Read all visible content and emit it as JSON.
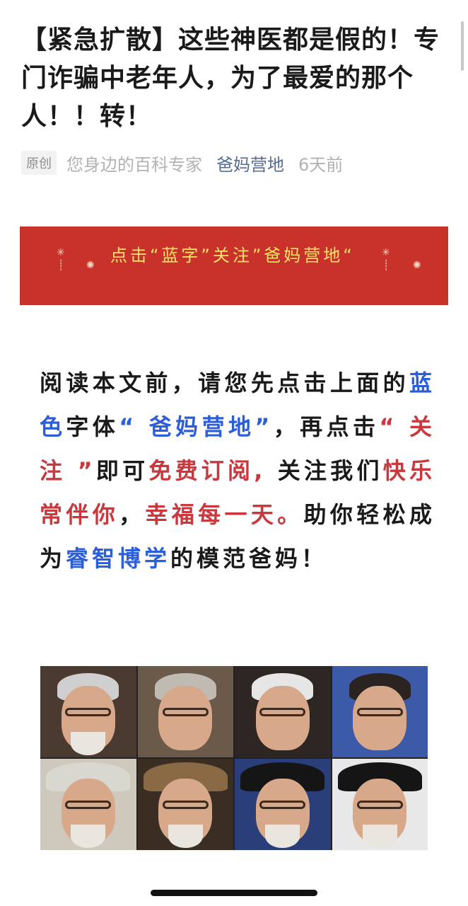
{
  "article": {
    "title": "【紧急扩散】这些神医都是假的！专门诈骗中老年人，为了最爱的那个人！！转！",
    "meta": {
      "badge": "原创",
      "author": "您身边的百科专家",
      "account": "爸妈营地",
      "time": "6天前"
    }
  },
  "banner": {
    "text": "点击“蓝字”关注”爸妈营地“"
  },
  "intro": {
    "p1": "阅读本文前，请您先点击上面的",
    "blue1": "蓝色",
    "p2": "字体",
    "blue2": "“ 爸妈营地”",
    "p3": "，再点击",
    "red1": "“ 关注 ”",
    "p4": "即可",
    "red2": "免费订阅,",
    "p5": " 关注我们",
    "red3": "快乐常伴你",
    "p6": "，",
    "red4": "幸福每一天。",
    "p7": "助你轻松成为",
    "blue3": "睿智博学",
    "p8": "的模范爸妈！"
  },
  "colors": {
    "banner_bg": "#c8322a",
    "banner_text": "#f7e36a",
    "account_link": "#576b95",
    "blue": "#2b5fd9",
    "red": "#c8383d"
  },
  "image": {
    "faces": [
      {
        "hair": "#cfcfcf",
        "bg": "#4a3a30",
        "glasses": true,
        "beard": true,
        "hat": null
      },
      {
        "hair": "#bfbab2",
        "bg": "#6b5a4a",
        "glasses": true,
        "beard": false,
        "hat": null
      },
      {
        "hair": "#e6e6e6",
        "bg": "#2d2623",
        "glasses": true,
        "beard": false,
        "hat": null
      },
      {
        "hair": "#2b2320",
        "bg": "#3c5aa8",
        "glasses": true,
        "beard": false,
        "hat": null
      },
      {
        "hair": "#d9d9d9",
        "bg": "#cfc8bc",
        "glasses": true,
        "beard": true,
        "hat": "#d8d8d0"
      },
      {
        "hair": "#7a5a3a",
        "bg": "#3a2e22",
        "glasses": true,
        "beard": true,
        "hat": "#8a6a45"
      },
      {
        "hair": "#111111",
        "bg": "#2a3f7a",
        "glasses": true,
        "beard": true,
        "hat": "#151515"
      },
      {
        "hair": "#111111",
        "bg": "#e8e8e8",
        "glasses": true,
        "beard": true,
        "hat": "#151515"
      }
    ]
  }
}
